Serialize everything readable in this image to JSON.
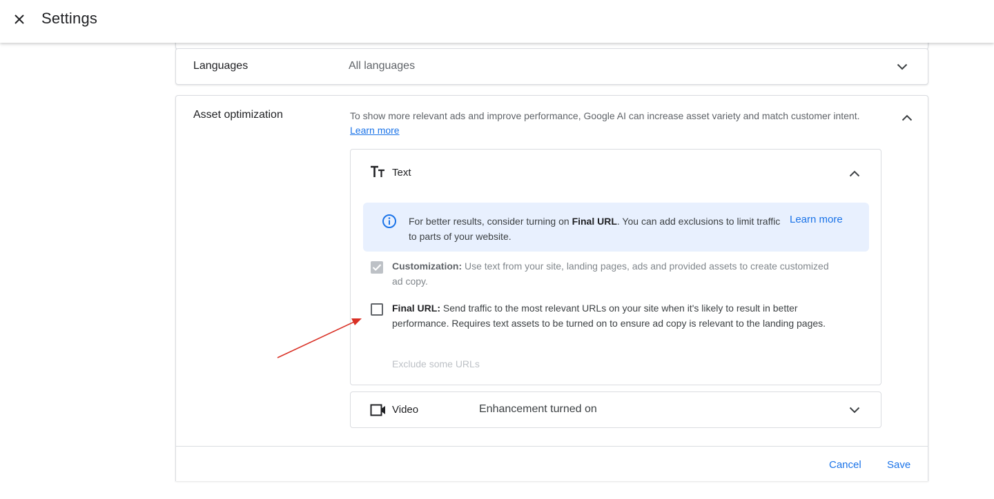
{
  "header": {
    "title": "Settings",
    "close_icon": "close-icon"
  },
  "languages": {
    "label": "Languages",
    "value": "All languages"
  },
  "asset_optimization": {
    "label": "Asset optimization",
    "description": "To show more relevant ads and improve performance, Google AI can increase asset variety and match customer intent.",
    "learn_more": "Learn more",
    "text_panel": {
      "title": "Text",
      "icon": "text-format-icon",
      "info": {
        "prefix": "For better results, consider turning on ",
        "bold": "Final URL",
        "suffix": ". You can add exclusions to limit traffic to parts of your website.",
        "link": "Learn more",
        "icon": "info-icon"
      },
      "customization": {
        "bold": "Customization:",
        "text": " Use text from your site, landing pages, ads and provided assets to create customized ad copy.",
        "checked": true,
        "disabled": true
      },
      "final_url": {
        "bold": "Final URL:",
        "text": " Send traffic to the most relevant URLs on your site when it's likely to result in better performance. Requires text assets to be turned on to ensure ad copy is relevant to the landing pages.",
        "checked": false
      },
      "exclude_link": "Exclude some URLs"
    },
    "video_panel": {
      "title": "Video",
      "icon": "video-icon",
      "status": "Enhancement turned on"
    }
  },
  "footer": {
    "cancel": "Cancel",
    "save": "Save"
  },
  "colors": {
    "accent": "#1a73e8",
    "info_bg": "#e8f0fe",
    "annotation_arrow": "#d93025"
  }
}
